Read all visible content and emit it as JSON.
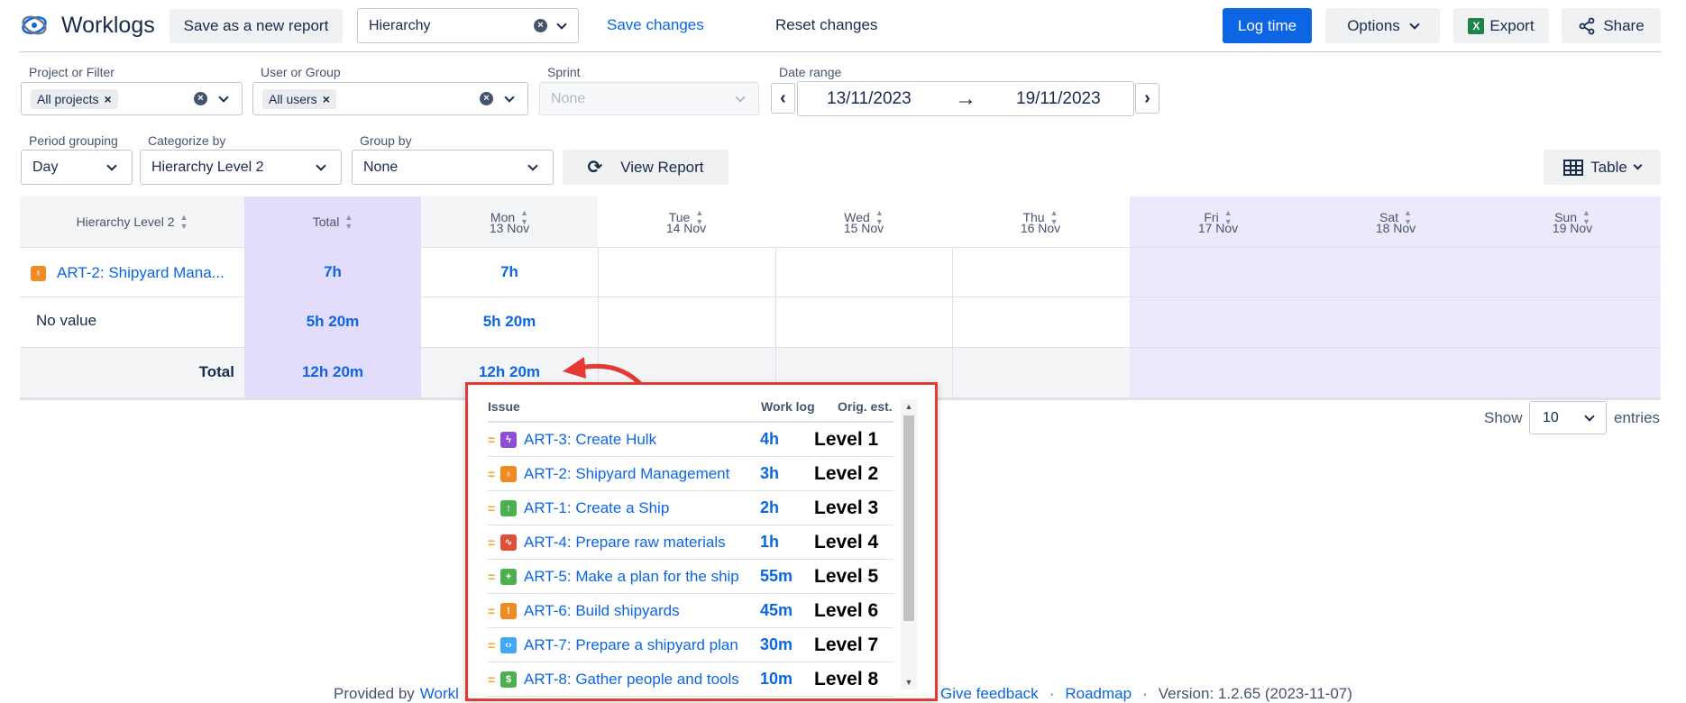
{
  "header": {
    "app_title": "Worklogs",
    "save_new_report": "Save as a new report",
    "report_select_value": "Hierarchy",
    "save_changes": "Save changes",
    "reset_changes": "Reset changes",
    "log_time": "Log time",
    "options": "Options",
    "export": "Export",
    "share": "Share"
  },
  "filters": {
    "project_label": "Project or Filter",
    "project_chip": "All projects",
    "user_label": "User or Group",
    "user_chip": "All users",
    "sprint_label": "Sprint",
    "sprint_placeholder": "None",
    "date_label": "Date range",
    "date_from": "13/11/2023",
    "date_to": "19/11/2023",
    "period_label": "Period grouping",
    "period_value": "Day",
    "categorize_label": "Categorize by",
    "categorize_value": "Hierarchy Level 2",
    "group_label": "Group by",
    "group_value": "None",
    "view_report": "View Report",
    "view_mode": "Table"
  },
  "table": {
    "col_category": "Hierarchy Level 2",
    "col_total": "Total",
    "days": [
      {
        "day": "Mon",
        "date": "13 Nov"
      },
      {
        "day": "Tue",
        "date": "14 Nov"
      },
      {
        "day": "Wed",
        "date": "15 Nov"
      },
      {
        "day": "Thu",
        "date": "16 Nov"
      },
      {
        "day": "Fri",
        "date": "17 Nov"
      },
      {
        "day": "Sat",
        "date": "18 Nov"
      },
      {
        "day": "Sun",
        "date": "19 Nov"
      }
    ],
    "rows": [
      {
        "label": "ART-2: Shipyard Mana...",
        "total": "7h",
        "mon": "7h"
      },
      {
        "label": "No value",
        "total": "5h 20m",
        "mon": "5h 20m"
      }
    ],
    "total_row": {
      "label": "Total",
      "total": "12h 20m",
      "mon": "12h 20m"
    }
  },
  "pagination": {
    "show": "Show",
    "entries_value": "10",
    "entries": "entries"
  },
  "popup": {
    "col_issue": "Issue",
    "col_worklog": "Work log",
    "col_orig": "Orig. est.",
    "items": [
      {
        "issue": "ART-3: Create Hulk",
        "log": "4h",
        "level": "Level 1",
        "icon_color": "#8f4dd7",
        "icon": "lightning-icon",
        "glyph": "ϟ"
      },
      {
        "issue": "ART-2: Shipyard Management",
        "log": "3h",
        "level": "Level 2",
        "icon_color": "#f08a24",
        "icon": "bulb-icon",
        "glyph": "♁"
      },
      {
        "issue": "ART-1: Create a Ship",
        "log": "2h",
        "level": "Level 3",
        "icon_color": "#4caf50",
        "icon": "arrow-up-icon",
        "glyph": "↑"
      },
      {
        "issue": "ART-4: Prepare raw materials",
        "log": "1h",
        "level": "Level 4",
        "icon_color": "#e04e39",
        "icon": "pulse-icon",
        "glyph": "∿"
      },
      {
        "issue": "ART-5: Make a plan for the ship",
        "log": "55m",
        "level": "Level 5",
        "icon_color": "#4caf50",
        "icon": "plus-icon",
        "glyph": "+"
      },
      {
        "issue": "ART-6: Build shipyards",
        "log": "45m",
        "level": "Level 6",
        "icon_color": "#f08a24",
        "icon": "exclamation-icon",
        "glyph": "!"
      },
      {
        "issue": "ART-7: Prepare a shipyard plan",
        "log": "30m",
        "level": "Level 7",
        "icon_color": "#3fa9f5",
        "icon": "code-icon",
        "glyph": "‹›"
      },
      {
        "issue": "ART-8: Gather people and tools",
        "log": "10m",
        "level": "Level 8",
        "icon_color": "#4caf50",
        "icon": "dollar-icon",
        "glyph": "$"
      }
    ]
  },
  "footer": {
    "provided_by": "Provided by",
    "provider_link": "Workl",
    "feedback": "Give feedback",
    "roadmap": "Roadmap",
    "version": "Version: 1.2.65 (2023-11-07)",
    "sep": "·"
  },
  "colors": {
    "accent": "#0c66e4",
    "highlight": "#e3dcfb",
    "weekend": "#ede9fc",
    "annotation": "#e53935"
  }
}
